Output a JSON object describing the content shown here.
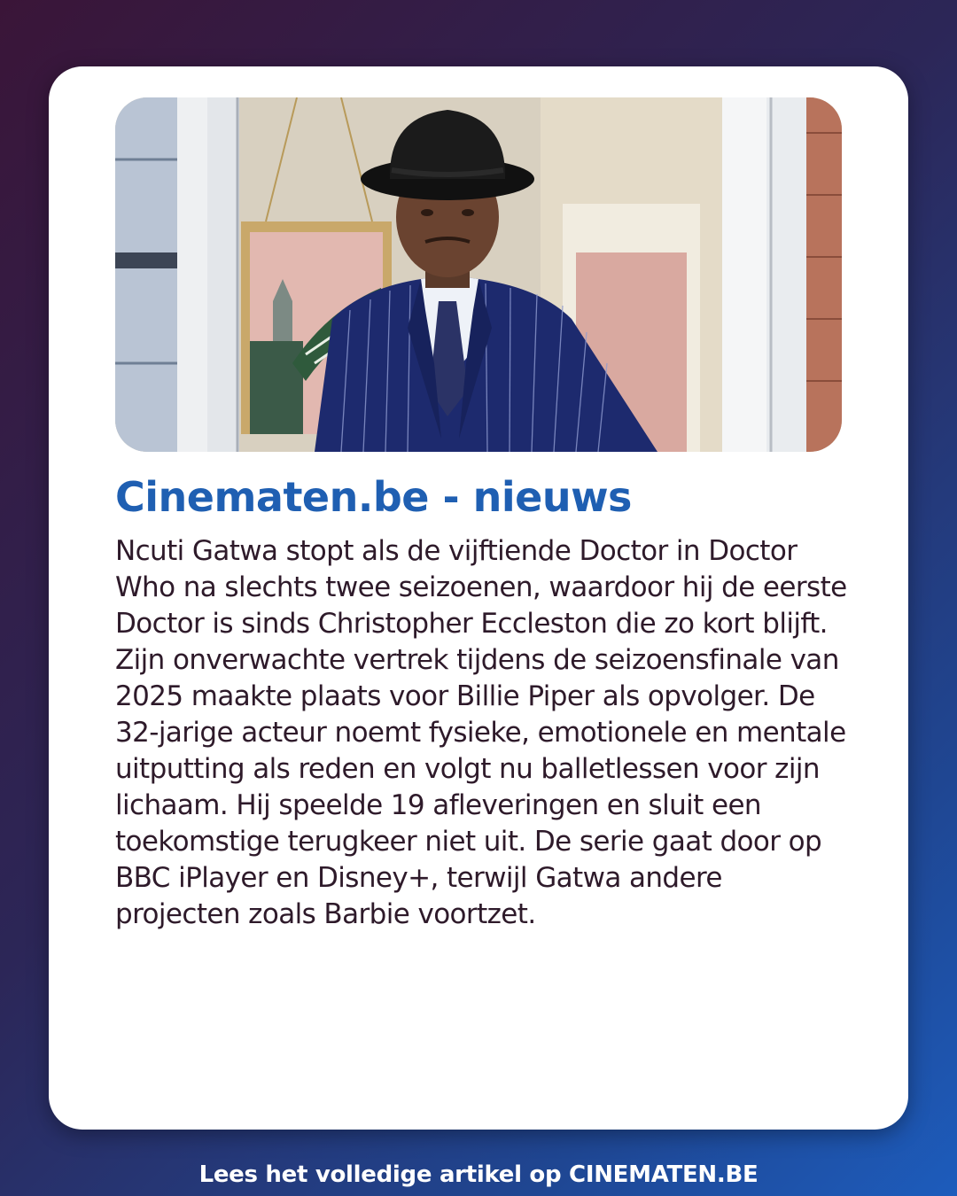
{
  "card": {
    "image": {
      "icon": "photo-icon",
      "subject": "Ncuti Gatwa"
    },
    "headline": "Cinematen.be - nieuws",
    "body": "Ncuti Gatwa stopt als de vijftiende Doctor in Doctor Who na slechts twee seizoenen, waardoor hij de eerste Doctor is sinds Christopher Eccleston die zo kort blijft. Zijn onverwachte vertrek tijdens de seizoensfinale van 2025 maakte plaats voor Billie Piper als opvolger. De 32-jarige acteur noemt fysieke, emotionele en mentale uitputting als reden en volgt nu balletlessen voor zijn lichaam. Hij speelde 19 afleveringen en sluit een toekomstige terugkeer niet uit. De serie gaat door op BBC iPlayer en Disney+, terwijl Gatwa andere projecten zoals Barbie voortzet."
  },
  "footer": {
    "cta": "Lees het volledige artikel op CINEMATEN.BE"
  },
  "colors": {
    "headline": "#1f5fb2",
    "body_text": "#2e1a2a",
    "card_bg": "#ffffff",
    "bg_gradient_start": "#3a1538",
    "bg_gradient_end": "#1d5cbc"
  }
}
